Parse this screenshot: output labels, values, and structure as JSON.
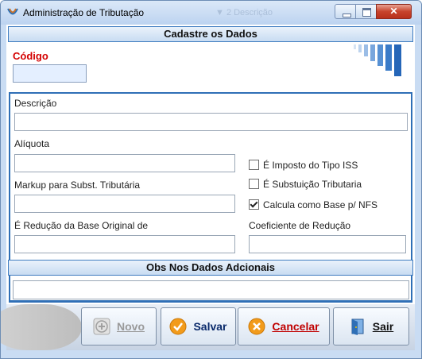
{
  "window": {
    "title": "Administração de Tributação",
    "ghost_text": "▼ 2 Descrição"
  },
  "header": {
    "title": "Cadastre os Dados"
  },
  "codigo": {
    "label": "Código",
    "value": ""
  },
  "form": {
    "descricao": {
      "label": "Descrição",
      "value": ""
    },
    "aliquota": {
      "label": "Alíquota",
      "value": ""
    },
    "markup": {
      "label": "Markup para Subst. Tributária",
      "value": ""
    },
    "reducao": {
      "label": "É Redução da Base Original de",
      "value": ""
    },
    "coeficiente": {
      "label": "Coeficiente de Redução",
      "value": ""
    }
  },
  "checks": [
    {
      "label": "É Imposto do Tipo ISS",
      "checked": false
    },
    {
      "label": "É Substuição Tributaria",
      "checked": false
    },
    {
      "label": "Calcula como Base p/ NFS",
      "checked": true
    }
  ],
  "obs": {
    "title": "Obs Nos Dados Adcionais",
    "value": ""
  },
  "buttons": {
    "novo": "Novo",
    "salvar": "Salvar",
    "cancelar": "Cancelar",
    "sair": "Sair"
  },
  "colors": {
    "accent": "#2f6fb6",
    "required_label": "#d40000",
    "close_button": "#c7432c"
  }
}
